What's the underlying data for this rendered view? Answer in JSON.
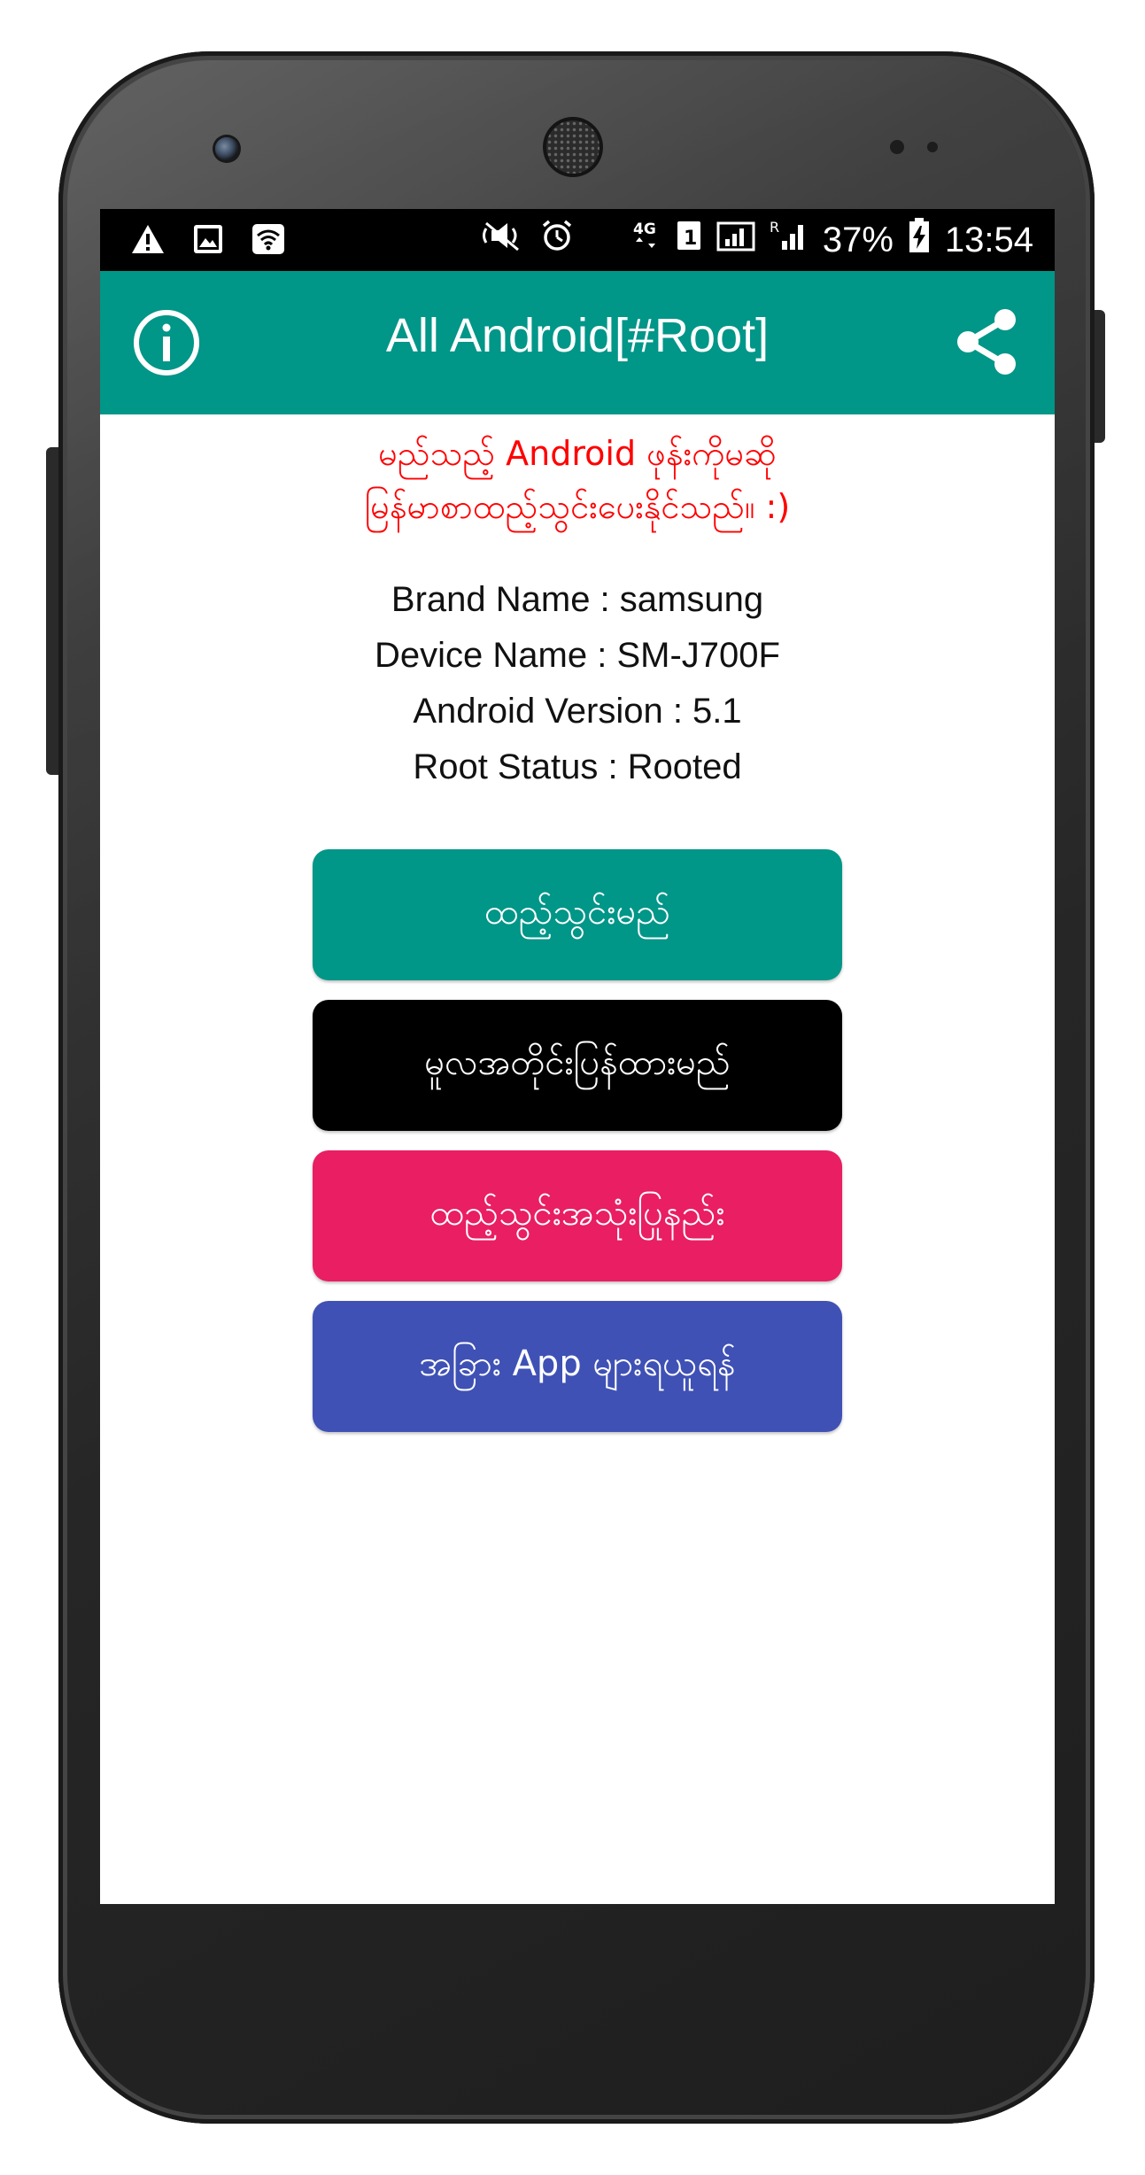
{
  "status_bar": {
    "left_icons": [
      "warning-icon",
      "image-icon",
      "wifi-icon"
    ],
    "right_icons": [
      "mute-icon",
      "alarm-icon",
      "4g-icon",
      "sim-icon",
      "signal-icon",
      "signal-roaming-icon",
      "battery-charging-icon"
    ],
    "battery": "37%",
    "time": "13:54"
  },
  "app_bar": {
    "title": "All Android[#Root]",
    "left_icon": "info-icon",
    "right_icon": "share-icon"
  },
  "tagline": {
    "line1": "မည်သည့် Android ဖုန်းကိုမဆို",
    "line2": "မြန်မာစာထည့်သွင်းပေးနိုင်သည်။ :)"
  },
  "device_info": {
    "brand": "Brand Name : samsung",
    "device": "Device Name : SM-J700F",
    "android_version": "Android Version : 5.1",
    "root_status": "Root Status : Rooted"
  },
  "buttons": [
    {
      "label": "ထည့်သွင်းမည်",
      "color": "#009688"
    },
    {
      "label": "မူလအတိုင်းပြန်ထားမည်",
      "color": "#000000"
    },
    {
      "label": "ထည့်သွင်းအသုံးပြုနည်း",
      "color": "#e91e63"
    },
    {
      "label": "အခြား App များရယူရန်",
      "color": "#3f51b5"
    }
  ],
  "colors": {
    "primary": "#009688",
    "tagline": "#ff0000"
  }
}
